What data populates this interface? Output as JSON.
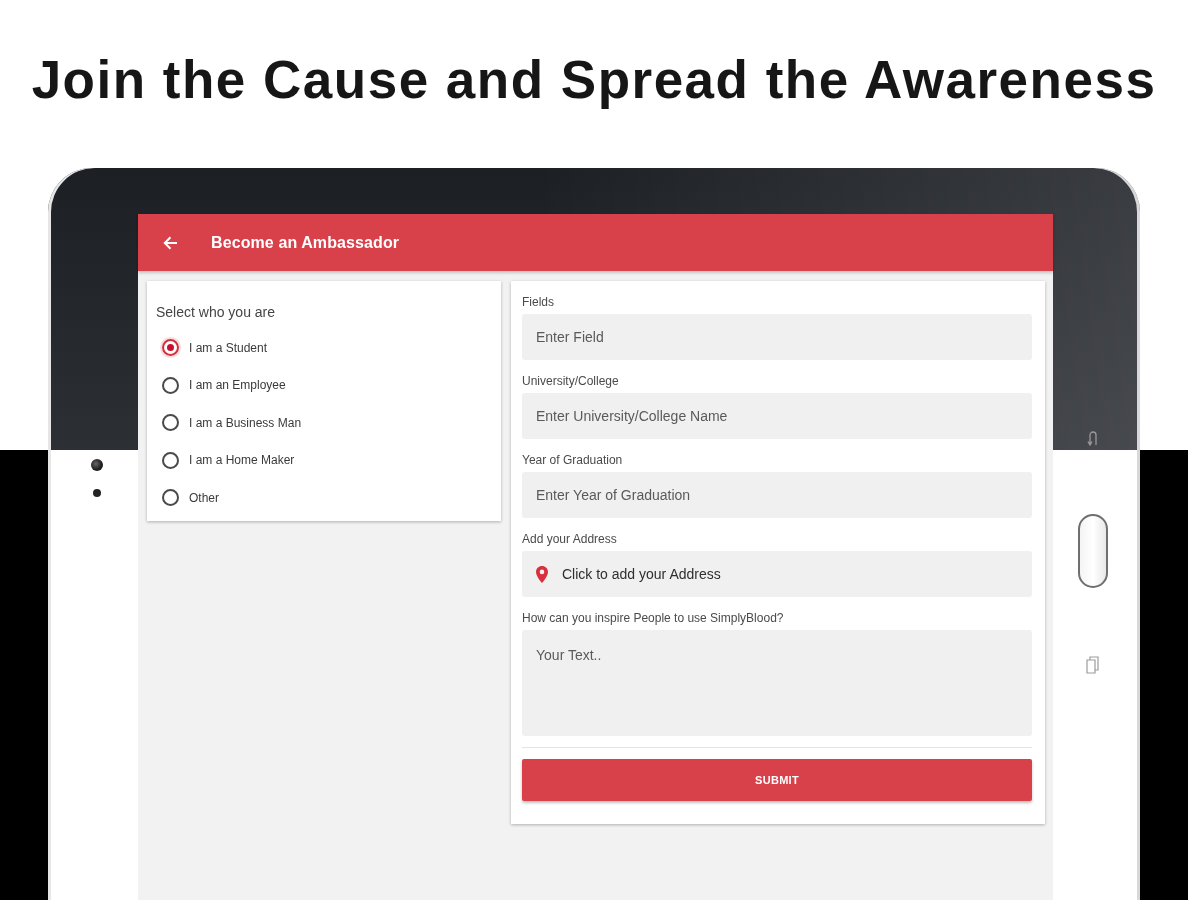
{
  "headline": "Join the Cause and Spread the Awareness",
  "app_bar": {
    "title": "Become an Ambassador"
  },
  "role_card": {
    "title": "Select who you are",
    "options": [
      {
        "label": "I am a Student",
        "selected": true
      },
      {
        "label": "I am an Employee",
        "selected": false
      },
      {
        "label": "I am a Business Man",
        "selected": false
      },
      {
        "label": "I am a Home Maker",
        "selected": false
      },
      {
        "label": "Other",
        "selected": false
      }
    ]
  },
  "form": {
    "fields": [
      {
        "kind": "text",
        "label": "Fields",
        "placeholder": "Enter Field"
      },
      {
        "kind": "text",
        "label": "University/College",
        "placeholder": "Enter University/College Name"
      },
      {
        "kind": "text",
        "label": "Year of Graduation",
        "placeholder": "Enter Year of Graduation"
      },
      {
        "kind": "location",
        "label": "Add your Address",
        "text": "Click to add your Address"
      },
      {
        "kind": "multiline",
        "label": "How can you inspire People to use SimplyBlood?",
        "placeholder": "Your Text.."
      }
    ],
    "submit": "SUBMIT"
  }
}
